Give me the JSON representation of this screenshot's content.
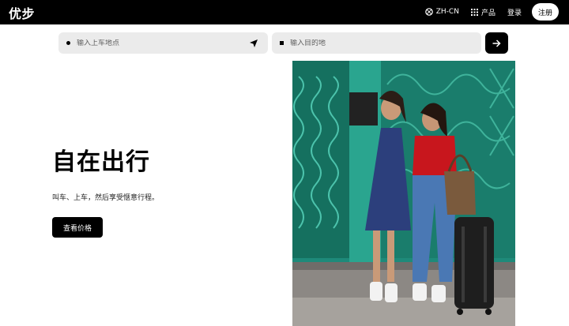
{
  "header": {
    "logo": "优步",
    "language": "ZH-CN",
    "products": "产品",
    "login": "登录",
    "signup": "注册"
  },
  "search": {
    "pickup_placeholder": "输入上车地点",
    "destination_placeholder": "输入目的地"
  },
  "hero": {
    "title": "自在出行",
    "subtitle": "叫车、上车，然后享受惬意行程。",
    "cta": "查看价格"
  },
  "icons": [
    "globe-icon",
    "grid-icon",
    "locate-arrow-icon",
    "arrow-right-icon"
  ]
}
